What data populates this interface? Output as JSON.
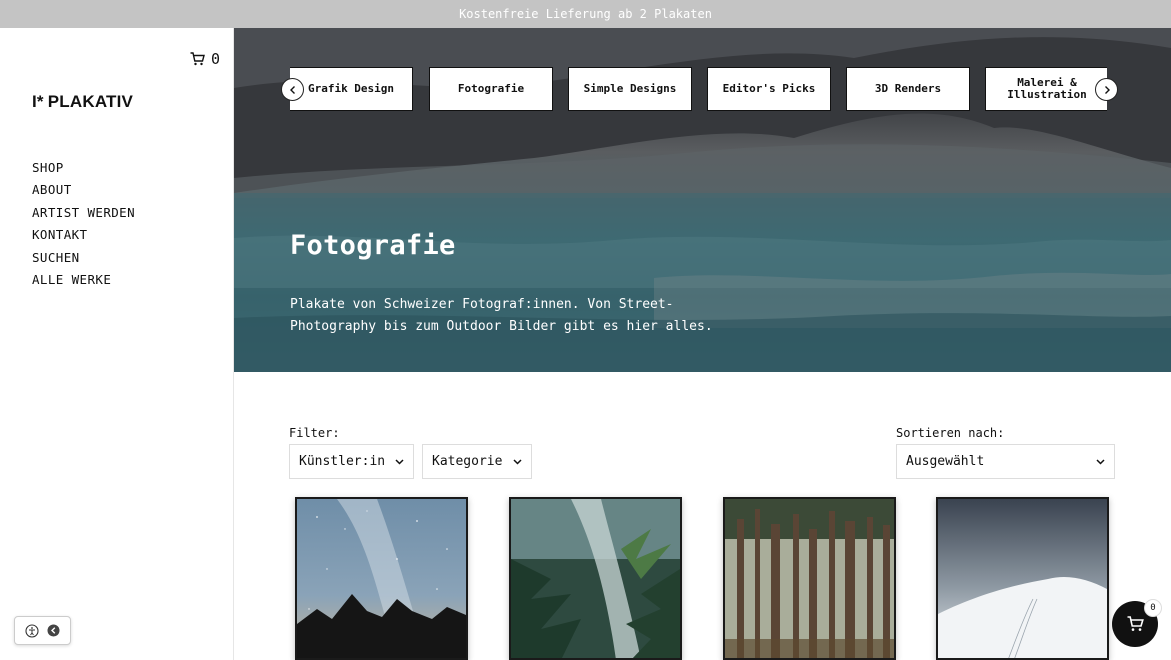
{
  "announcement": "Kostenfreie Lieferung ab 2 Plakaten",
  "header": {
    "cart_count": "0"
  },
  "brand": {
    "name": "PLAKATIV",
    "mark": "I*"
  },
  "nav": {
    "items": [
      "SHOP",
      "ABOUT",
      "ARTIST WERDEN",
      "KONTAKT",
      "SUCHEN",
      "ALLE WERKE"
    ]
  },
  "categories": [
    "Grafik Design",
    "Fotografie",
    "Simple Designs",
    "Editor's Picks",
    "3D Renders",
    "Malerei & Illustration"
  ],
  "hero": {
    "title": "Fotografie",
    "description": "Plakate von Schweizer Fotograf:innen. Von Street-Photography bis zum Outdoor Bilder gibt es hier alles."
  },
  "filters": {
    "label": "Filter:",
    "artist": "Künstler:in",
    "category": "Kategorie",
    "sort_label": "Sortieren nach:",
    "sort_value": "Ausgewählt"
  },
  "products": [
    {
      "subject": "milky way over mountain silhouette"
    },
    {
      "subject": "waterfall with tropical plants"
    },
    {
      "subject": "pine forest trunks"
    },
    {
      "subject": "snowy mountain slope in fog"
    }
  ],
  "cart_fab": {
    "count": "0"
  },
  "colors": {
    "announcement_bg": "#c4c4c4",
    "accent": "#111111",
    "lake": "#3e6a73"
  }
}
